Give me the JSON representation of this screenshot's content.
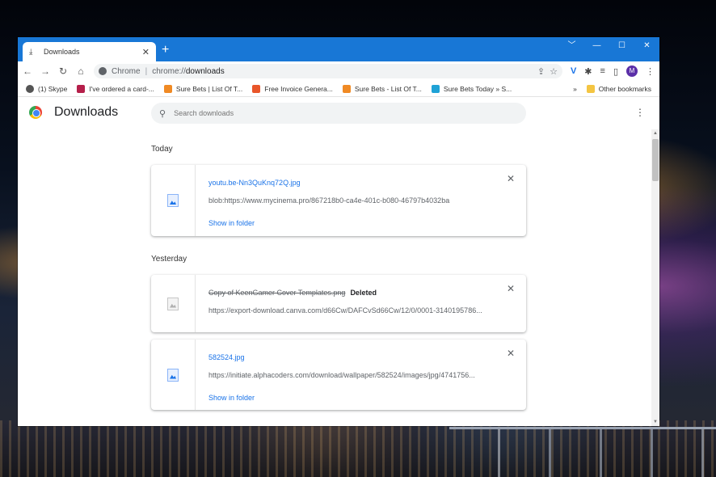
{
  "tab": {
    "title": "Downloads",
    "close": "✕"
  },
  "newtab": "+",
  "window_controls": {
    "menu": "﹀",
    "minimize": "—",
    "maximize": "☐",
    "close": "✕"
  },
  "toolbar": {
    "back": "←",
    "forward": "→",
    "reload": "↻",
    "home": "⌂",
    "scheme": "Chrome",
    "separator": "|",
    "url_prefix": "chrome://",
    "url_path": "downloads",
    "share": "⇪",
    "star": "☆",
    "ext1": "V",
    "extensions": "✱",
    "media": "≡",
    "sidepanel": "▯",
    "avatar_letter": "M",
    "menu": "⋮"
  },
  "bookmarks": [
    {
      "label": "(1) Skype",
      "color": "#555"
    },
    {
      "label": "I've ordered a card-...",
      "color": "#b51f4a"
    },
    {
      "label": "Sure Bets | List Of T...",
      "color": "#f08a24"
    },
    {
      "label": "Free Invoice Genera...",
      "color": "#e8562a"
    },
    {
      "label": "Sure Bets - List Of T...",
      "color": "#f08a24"
    },
    {
      "label": "Sure Bets Today » S...",
      "color": "#1fa2d6"
    }
  ],
  "bookmarks_more": "»",
  "other_bookmarks": "Other bookmarks",
  "page": {
    "title": "Downloads",
    "search_placeholder": "Search downloads",
    "menu": "⋮"
  },
  "sections": [
    {
      "label": "Today"
    },
    {
      "label": "Yesterday"
    }
  ],
  "downloads": [
    {
      "filename": "youtu.be-Nn3QuKnq72Q.jpg",
      "url": "blob:https://www.mycinema.pro/867218b0-ca4e-401c-b080-46797b4032ba",
      "action": "Show in folder",
      "status": ""
    },
    {
      "filename": "Copy of KeenGamer Cover Templates.png",
      "url": "https://export-download.canva.com/d66Cw/DAFCvSd66Cw/12/0/0001-3140195786...",
      "action": "",
      "status": "Deleted"
    },
    {
      "filename": "582524.jpg",
      "url": "https://initiate.alphacoders.com/download/wallpaper/582524/images/jpg/4741756...",
      "action": "Show in folder",
      "status": ""
    }
  ],
  "remove_glyph": "✕",
  "scroll": {
    "up": "▲",
    "down": "▼"
  }
}
